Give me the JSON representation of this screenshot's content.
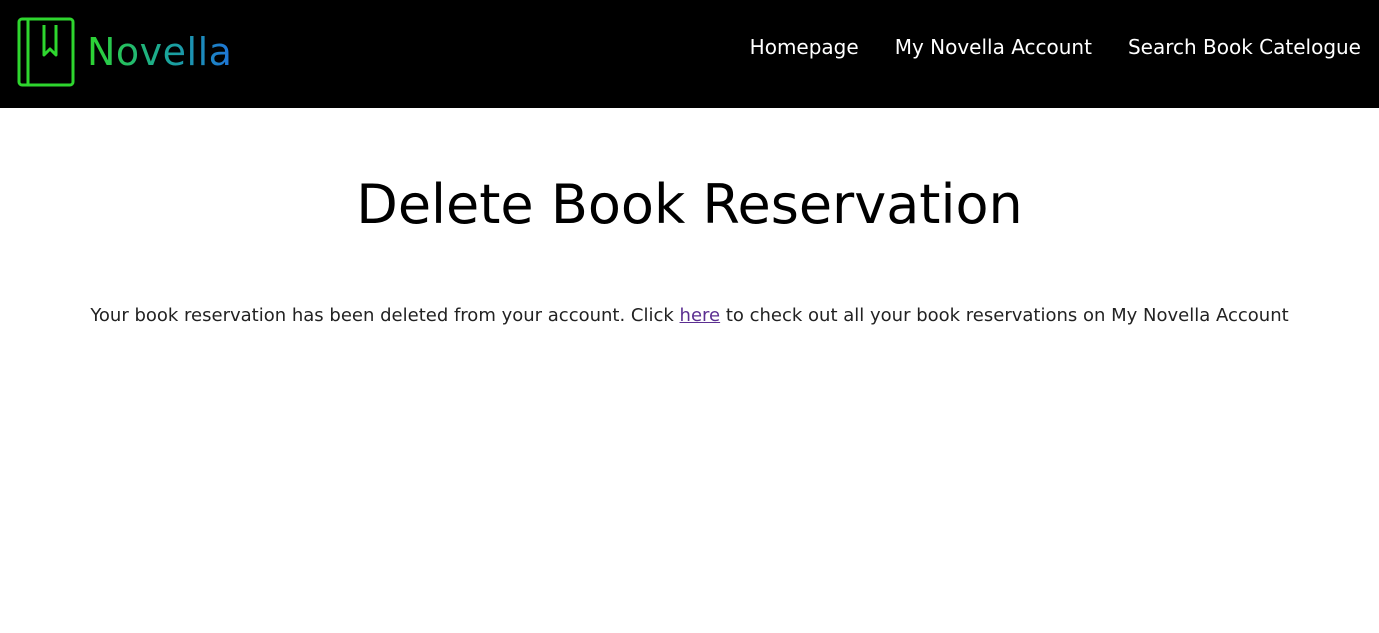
{
  "brand": {
    "name": "Novella",
    "icon": "bookmarked-book-icon",
    "colors": {
      "icon_green": "#2ed62e",
      "gradient_start": "#2ed62e",
      "gradient_end": "#1e74d8"
    }
  },
  "nav": {
    "items": [
      {
        "label": "Homepage"
      },
      {
        "label": "My Novella Account"
      },
      {
        "label": "Search Book Catelogue"
      }
    ],
    "background": "#000000",
    "text_color": "#ffffff"
  },
  "main": {
    "title": "Delete Book Reservation",
    "message_prefix": "Your book reservation has been deleted from your account. Click ",
    "link_text": "here",
    "message_suffix": " to check out all your book reservations on My Novella Account",
    "link_color": "#5b2e91"
  }
}
